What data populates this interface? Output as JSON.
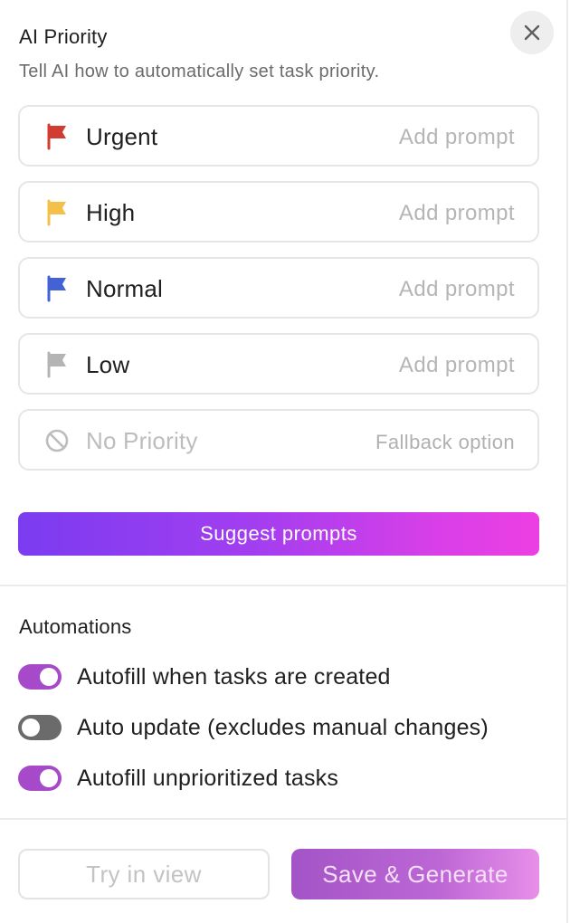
{
  "header": {
    "title": "AI Priority",
    "subtitle": "Tell AI how to automatically set task priority.",
    "close_icon": "close-icon"
  },
  "priorities": [
    {
      "label": "Urgent",
      "hint": "Add prompt",
      "icon": "flag-icon",
      "color": "#d13b32"
    },
    {
      "label": "High",
      "hint": "Add prompt",
      "icon": "flag-icon",
      "color": "#f5c04a"
    },
    {
      "label": "Normal",
      "hint": "Add prompt",
      "icon": "flag-icon",
      "color": "#4262d6"
    },
    {
      "label": "Low",
      "hint": "Add prompt",
      "icon": "flag-icon",
      "color": "#b4b4b4"
    },
    {
      "label": "No Priority",
      "hint": "Fallback option",
      "icon": "no-priority-icon",
      "color": "#bdbdbd"
    }
  ],
  "suggest_button": "Suggest prompts",
  "automations": {
    "title": "Automations",
    "items": [
      {
        "label": "Autofill when tasks are created",
        "enabled": true
      },
      {
        "label": "Auto update (excludes manual changes)",
        "enabled": false
      },
      {
        "label": "Autofill unprioritized tasks",
        "enabled": true
      }
    ]
  },
  "footer": {
    "try_label": "Try in view",
    "save_label": "Save & Generate"
  },
  "colors": {
    "accent_purple": "#a64ac9",
    "suggest_gradient_start": "#7b3cf0",
    "suggest_gradient_end": "#ec3fe3"
  }
}
